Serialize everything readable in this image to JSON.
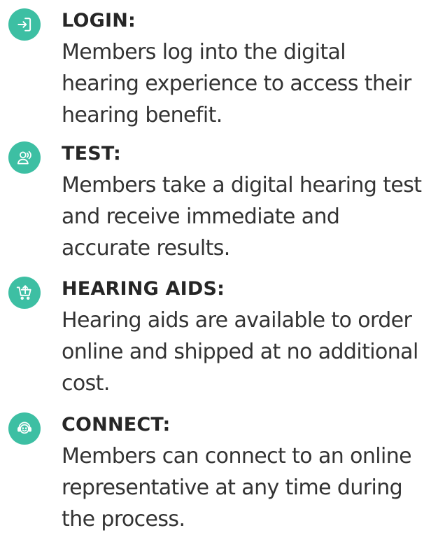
{
  "colors": {
    "accent": "#3dbfa3",
    "heading": "#262626",
    "body": "#333333"
  },
  "steps": [
    {
      "icon": "login-icon",
      "title": "LOGIN:",
      "description": "Members log into the digital hearing experience to access their hearing benefit."
    },
    {
      "icon": "hearing-test-icon",
      "title": "TEST:",
      "description": "Members take a digital hearing test and receive immediate and accurate results."
    },
    {
      "icon": "shopping-cart-icon",
      "title": "HEARING AIDS:",
      "description": "Hearing aids are available to order online and shipped at no additional cost."
    },
    {
      "icon": "support-agent-icon",
      "title": "CONNECT:",
      "description": "Members can connect to an online representative at any time during the process."
    }
  ]
}
